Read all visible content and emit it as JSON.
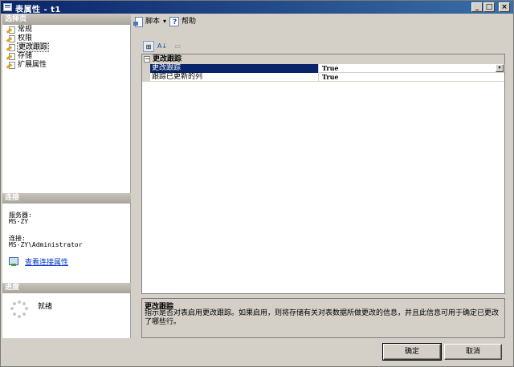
{
  "window": {
    "title": "表属性 - t1",
    "minimize_glyph": "_",
    "maximize_glyph": "□",
    "close_glyph": "×"
  },
  "left": {
    "select_page_header": "选择页",
    "pages": [
      {
        "label": "常规",
        "icon": "page-wrench-icon"
      },
      {
        "label": "权限",
        "icon": "page-wrench-icon"
      },
      {
        "label": "更改跟踪",
        "icon": "page-wrench-icon",
        "selected": true
      },
      {
        "label": "存储",
        "icon": "page-wrench-icon"
      },
      {
        "label": "扩展属性",
        "icon": "page-wrench-icon"
      }
    ],
    "connection_header": "连接",
    "server_label": "服务器:",
    "server_value": "MS-ZY",
    "connection_label": "连接:",
    "connection_value": "MS-ZY\\Administrator",
    "view_connection_link": "查看连接属性",
    "progress_header": "进度",
    "progress_status": "就绪"
  },
  "toolbar": {
    "script_label": "脚本",
    "script_dropdown_glyph": "▾",
    "help_label": "帮助"
  },
  "grid_tools": {
    "categorized_glyph": "⊞",
    "alphabetical_glyph": "A↓",
    "pages_glyph": "▭"
  },
  "grid": {
    "category": {
      "label": "更改跟踪",
      "toggle": "−"
    },
    "properties": [
      {
        "name": "更改跟踪",
        "value": "True",
        "selected": true
      },
      {
        "name": "跟踪已更新的列",
        "value": "True",
        "selected": false
      }
    ],
    "dropdown_glyph": "▾"
  },
  "description": {
    "title": "更改跟踪",
    "text": "指示是否对表启用更改跟踪。如果启用，则将存储有关对表数据所做更改的信息，并且此信息可用于确定已更改了哪些行。"
  },
  "buttons": {
    "ok": "确定",
    "cancel": "取消"
  }
}
